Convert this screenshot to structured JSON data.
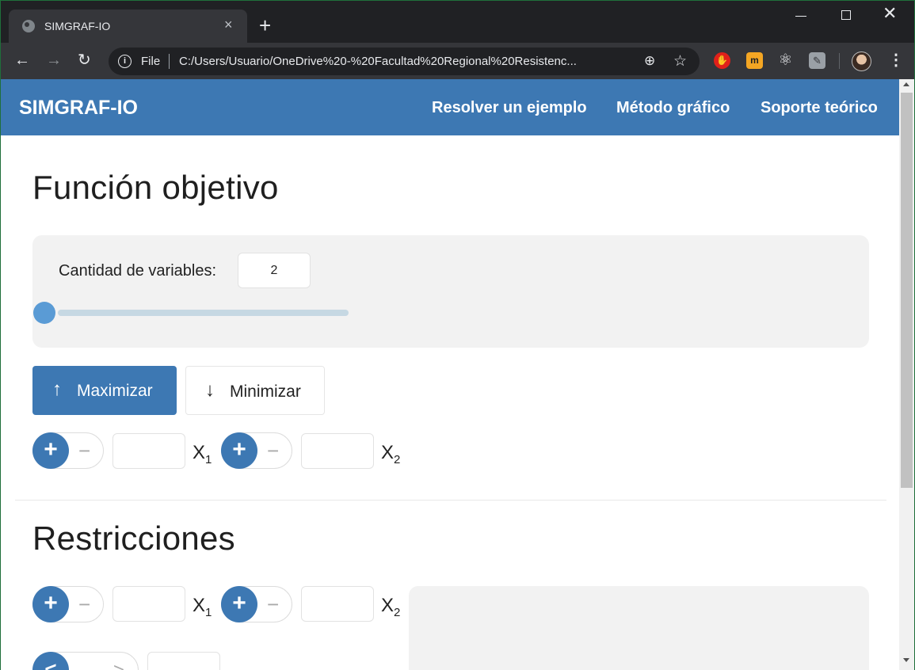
{
  "browser": {
    "tab_title": "SIMGRAF-IO",
    "tab_close": "×",
    "new_tab": "+",
    "scheme_label": "File",
    "url": "C:/Users/Usuario/OneDrive%20-%20Facultad%20Regional%20Resistenc...",
    "icons": [
      "globe-icon",
      "close-icon",
      "back-icon",
      "forward-icon",
      "reload-icon",
      "info-icon",
      "zoom-icon",
      "star-icon",
      "adblock-icon",
      "extension-m-icon",
      "react-devtools-icon",
      "pin-extension-icon",
      "profile-avatar",
      "menu-icon"
    ]
  },
  "navbar": {
    "brand": "SIMGRAF-IO",
    "links": [
      "Resolver un ejemplo",
      "Método gráfico",
      "Soporte teórico"
    ],
    "bg_color": "#3d78b3"
  },
  "objective": {
    "title": "Función objetivo",
    "variables_label": "Cantidad de variables:",
    "variables_value": "2",
    "slider_fraction": 0.0,
    "maximize_label": "Maximizar",
    "minimize_label": "Minimizar",
    "selected_mode": "Maximizar",
    "terms": [
      {
        "sign_plus": "+",
        "sign_minus": "−",
        "coef": "",
        "var": "X",
        "sub": "1"
      },
      {
        "sign_plus": "+",
        "sign_minus": "−",
        "coef": "",
        "var": "X",
        "sub": "2"
      }
    ]
  },
  "constraints": {
    "title": "Restricciones",
    "terms": [
      {
        "sign_plus": "+",
        "sign_minus": "−",
        "coef": "",
        "var": "X",
        "sub": "1"
      },
      {
        "sign_plus": "+",
        "sign_minus": "−",
        "coef": "",
        "var": "X",
        "sub": "2"
      }
    ],
    "relation_selected": "<",
    "relation_other": ">",
    "rhs": ""
  },
  "colors": {
    "accent": "#3d78b3",
    "slider_thumb": "#5a9bd5",
    "panel_bg": "#f2f2f2"
  }
}
